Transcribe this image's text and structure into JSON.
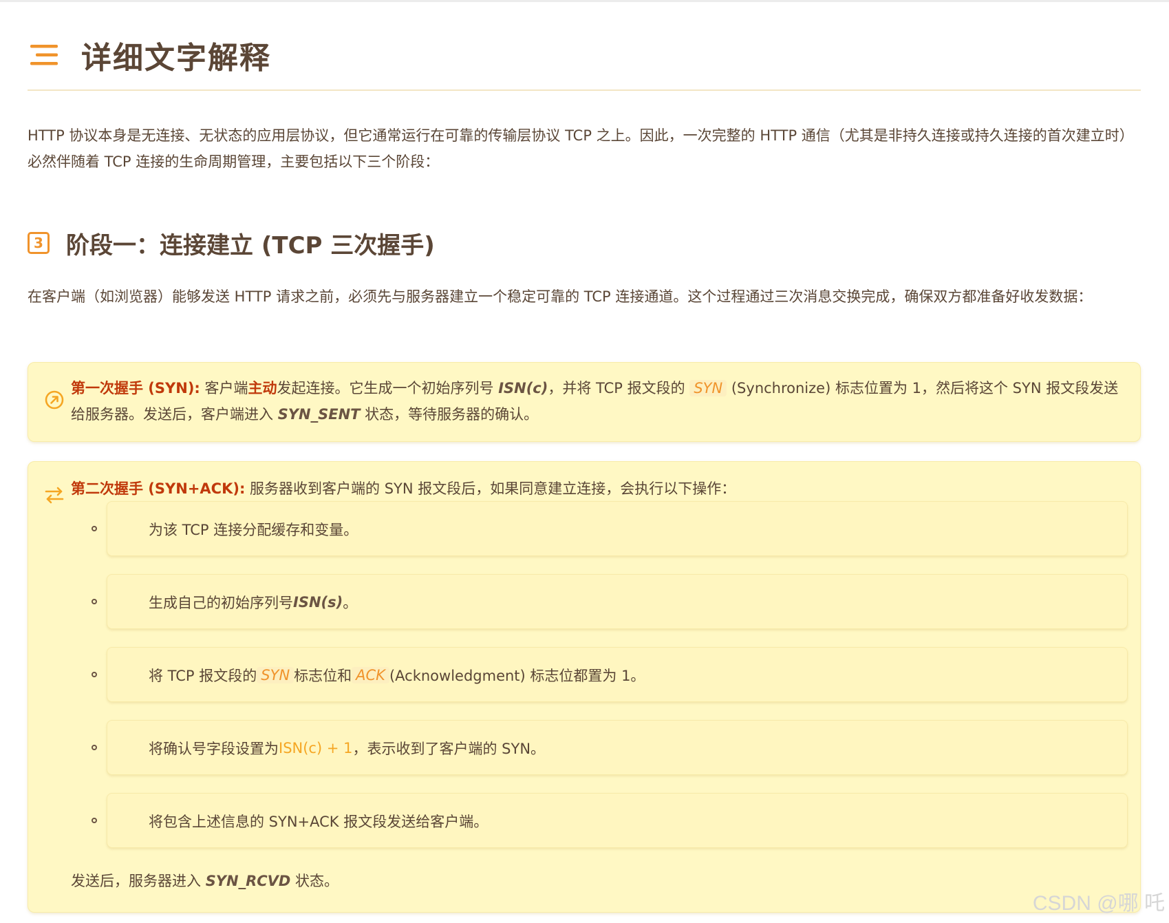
{
  "header": {
    "title": "详细文字解释",
    "icon": "menu-lines-icon"
  },
  "intro": "HTTP 协议本身是无连接、无状态的应用层协议，但它通常运行在可靠的传输层协议 TCP 之上。因此，一次完整的 HTTP 通信（尤其是非持久连接或持久连接的首次建立时）必然伴随着 TCP 连接的生命周期管理，主要包括以下三个阶段：",
  "stage1": {
    "badge": "3",
    "title": "阶段一：连接建立 (TCP 三次握手)",
    "intro": "在客户端（如浏览器）能够发送 HTTP 请求之前，必须先与服务器建立一个稳定可靠的 TCP 连接通道。这个过程通过三次消息交换完成，确保双方都准备好收发数据："
  },
  "handshake1": {
    "label": "第一次握手 (SYN):",
    "t1": " 客户端",
    "t1_strong": "主动",
    "t2": "发起连接。它生成一个初始序列号 ",
    "isn": "ISN(c)",
    "t3": "，并将 TCP 报文段的 ",
    "syn": "SYN",
    "t4": " (Synchronize) 标志位置为 1，然后将这个 SYN 报文段发送给服务器。发送后，客户端进入 ",
    "state": "SYN_SENT",
    "t5": " 状态，等待服务器的确认。"
  },
  "handshake2": {
    "label": "第二次握手 (SYN+ACK):",
    "text": " 服务器收到客户端的 SYN 报文段后，如果同意建立连接，会执行以下操作：",
    "items": {
      "i1": "为该 TCP 连接分配缓存和变量。",
      "i2_a": "生成自己的初始序列号 ",
      "i2_em": "ISN(s)",
      "i2_b": "。",
      "i3_a": "将 TCP 报文段的 ",
      "i3_syn": "SYN",
      "i3_b": " 标志位和 ",
      "i3_ack": "ACK",
      "i3_c": " (Acknowledgment) 标志位都置为 1。",
      "i4_a": "将确认号字段设置为 ",
      "i4_accent": "ISN(c) + 1",
      "i4_b": "，表示收到了客户端的 SYN。",
      "i5": "将包含上述信息的 SYN+ACK 报文段发送给客户端。"
    },
    "after_a": "发送后，服务器进入 ",
    "after_state": "SYN_RCVD",
    "after_b": " 状态。"
  },
  "watermark": "CSDN @哪 吒",
  "colors": {
    "accent": "#f0932b",
    "label": "#c0390b",
    "card_bg": "#fff8c4"
  }
}
